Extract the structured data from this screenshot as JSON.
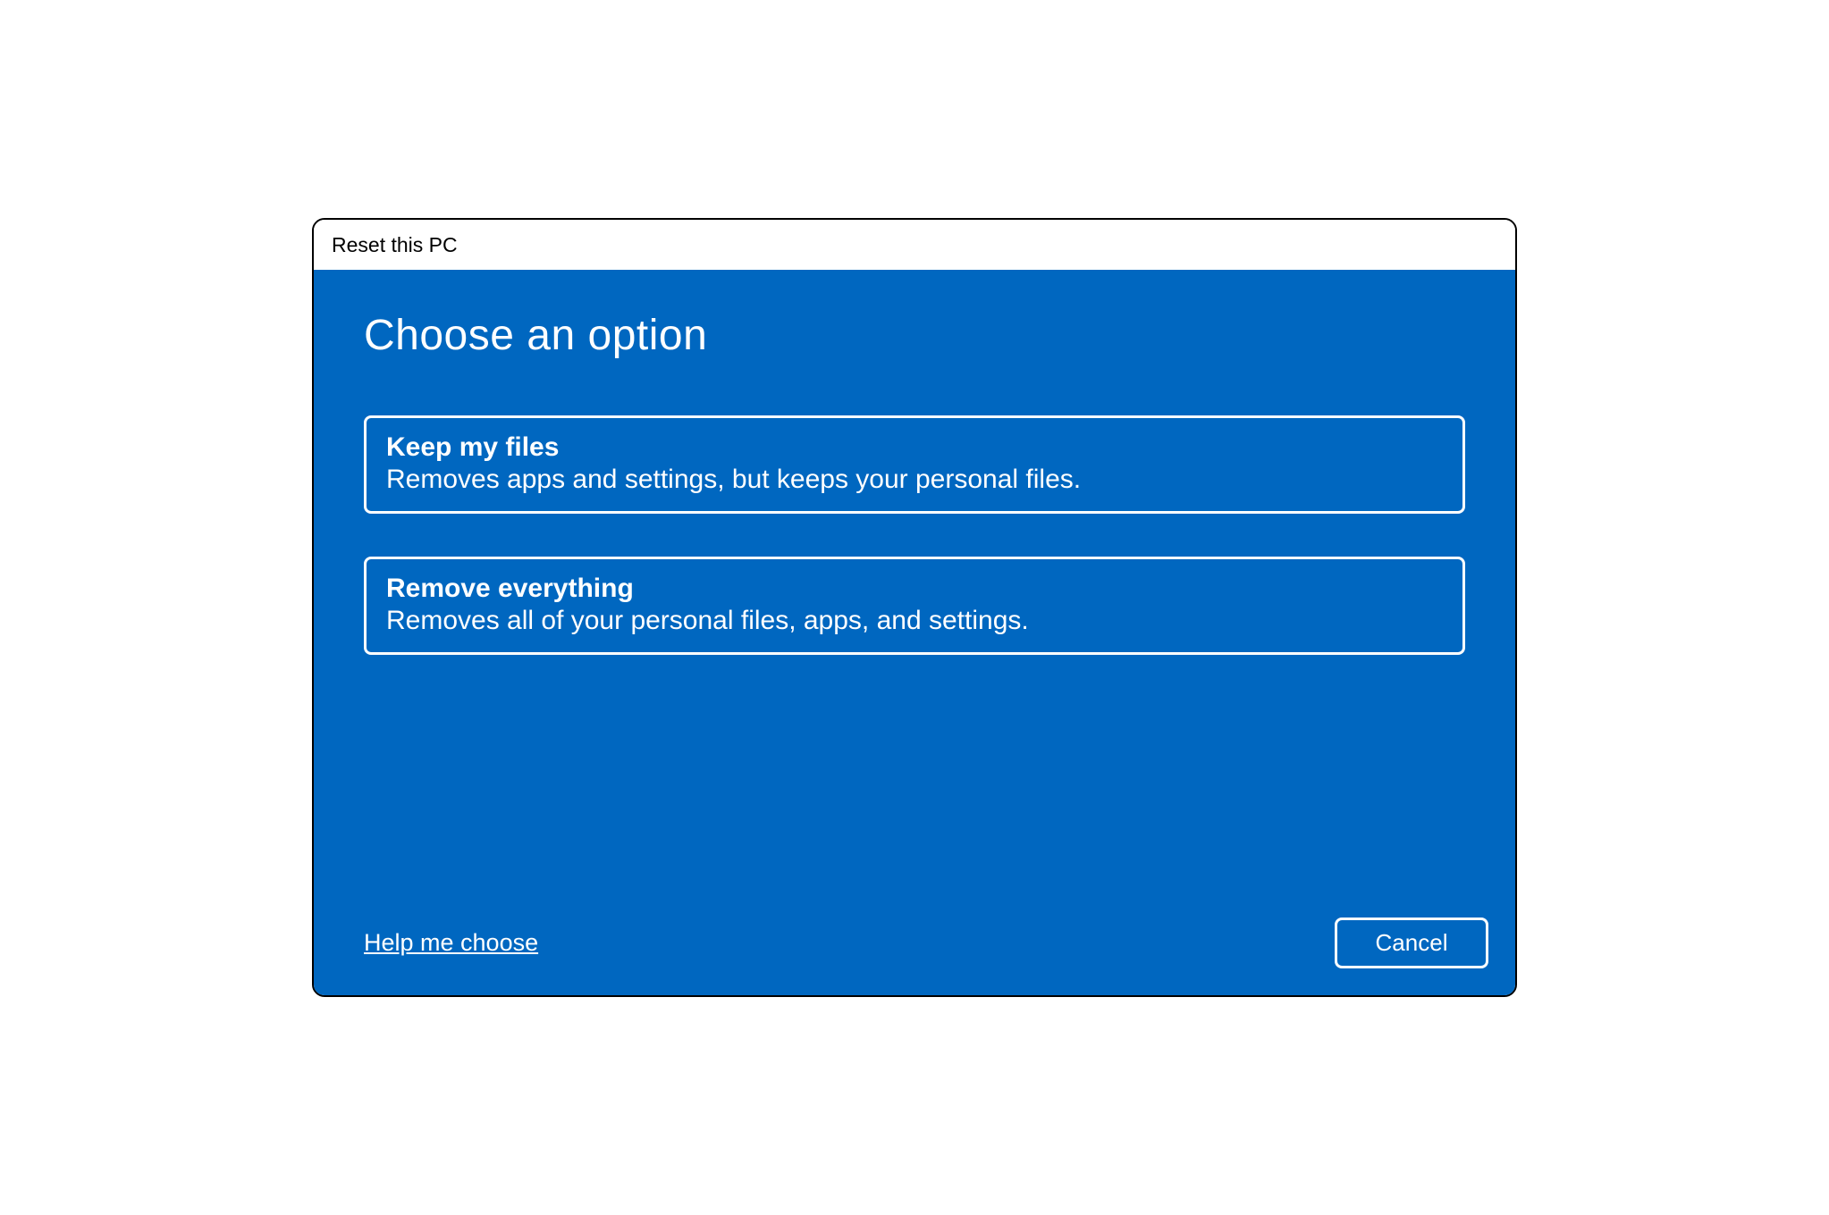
{
  "window": {
    "title": "Reset this PC"
  },
  "main": {
    "heading": "Choose an option",
    "options": [
      {
        "title": "Keep my files",
        "description": "Removes apps and settings, but keeps your personal files."
      },
      {
        "title": "Remove everything",
        "description": "Removes all of your personal files, apps, and settings."
      }
    ]
  },
  "footer": {
    "help_link": "Help me choose",
    "cancel_label": "Cancel"
  }
}
